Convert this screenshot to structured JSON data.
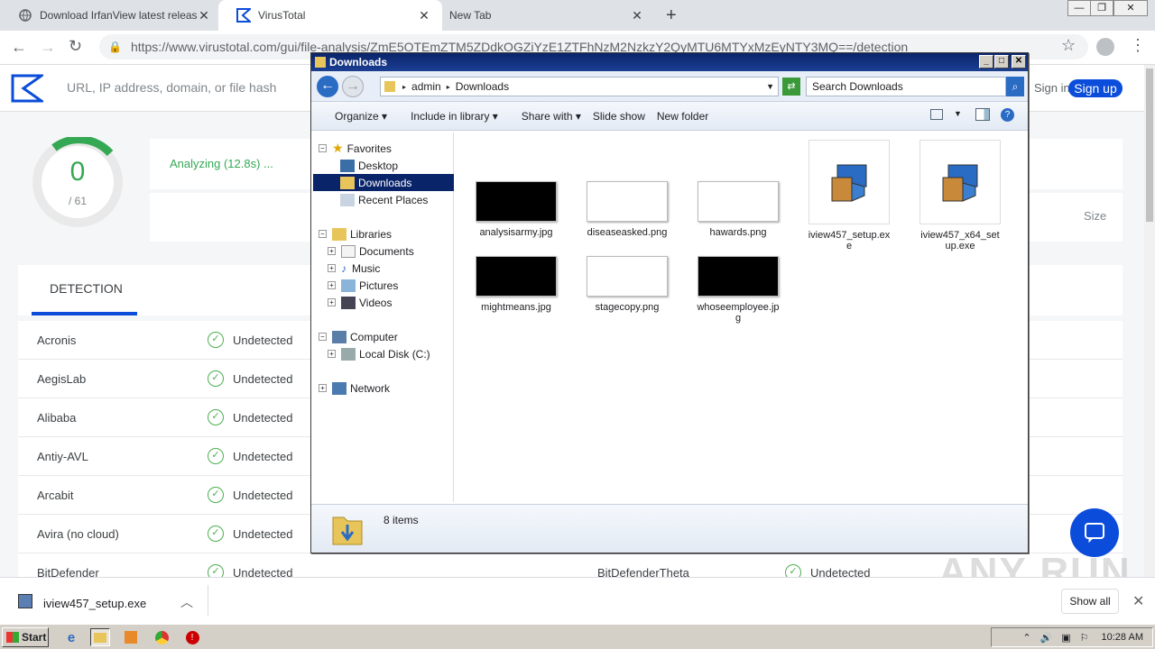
{
  "browser": {
    "tabs": [
      {
        "label": "Download IrfanView latest release",
        "active": false
      },
      {
        "label": "VirusTotal",
        "active": true
      },
      {
        "label": "New Tab",
        "active": false
      }
    ],
    "url": "https://www.virustotal.com/gui/file-analysis/ZmE5OTEmZTM5ZDdkOGZiYzE1ZTFhNzM2NzkzY2QyMTU6MTYxMzEyNTY3MQ==/detection"
  },
  "vt": {
    "search_placeholder": "URL, IP address, domain, or file hash",
    "sign_in": "Sign in",
    "sign_up": "Sign up",
    "score": "0",
    "score_total": "/ 61",
    "analyzing": "Analyzing (12.8s) ...",
    "size_label": "Size",
    "detection_tab": "DETECTION",
    "rows": [
      {
        "engine": "Acronis",
        "result": "Undetected"
      },
      {
        "engine": "AegisLab",
        "result": "Undetected"
      },
      {
        "engine": "Alibaba",
        "result": "Undetected"
      },
      {
        "engine": "Antiy-AVL",
        "result": "Undetected"
      },
      {
        "engine": "Arcabit",
        "result": "Undetected"
      },
      {
        "engine": "Avira (no cloud)",
        "result": "Undetected"
      },
      {
        "engine": "BitDefender",
        "result": "Undetected",
        "engine2": "BitDefenderTheta",
        "result2": "Undetected"
      }
    ]
  },
  "explorer": {
    "title": "Downloads",
    "breadcrumb": [
      "admin",
      "Downloads"
    ],
    "search_placeholder": "Search Downloads",
    "commands": [
      "Organize",
      "Include in library",
      "Share with",
      "Slide show",
      "New folder"
    ],
    "tree": {
      "favorites": "Favorites",
      "desktop": "Desktop",
      "downloads": "Downloads",
      "recent": "Recent Places",
      "libraries": "Libraries",
      "documents": "Documents",
      "music": "Music",
      "pictures": "Pictures",
      "videos": "Videos",
      "computer": "Computer",
      "localdisk": "Local Disk (C:)",
      "network": "Network"
    },
    "files": [
      {
        "name": "analysisarmy.jpg"
      },
      {
        "name": "diseaseasked.png"
      },
      {
        "name": "hawards.png"
      },
      {
        "name": "iview457_setup.exe"
      },
      {
        "name": "iview457_x64_setup.exe"
      },
      {
        "name": "mightmeans.jpg"
      },
      {
        "name": "stagecopy.png"
      },
      {
        "name": "whoseemployee.jpg"
      }
    ],
    "status": "8 items"
  },
  "downloads_bar": {
    "file": "iview457_setup.exe",
    "show_all": "Show all"
  },
  "taskbar": {
    "start": "Start",
    "time": "10:28 AM"
  },
  "watermark": "ANY RUN"
}
